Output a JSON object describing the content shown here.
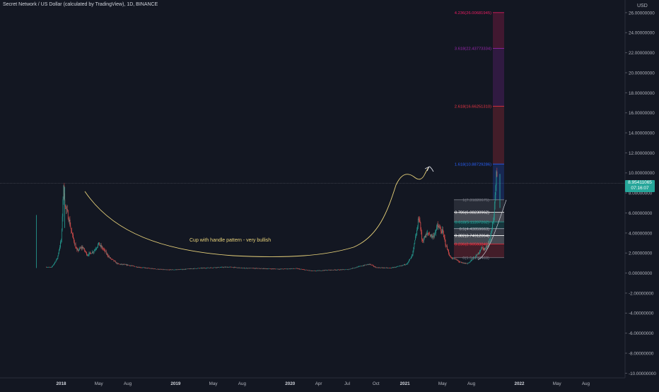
{
  "header": {
    "title": "Secret Network / US Dollar (calculated by TradingView), 1D, BINANCE",
    "currency": "USD"
  },
  "price_badge": {
    "price": "8.95411065",
    "countdown": "07:16:07"
  },
  "annotation": {
    "pattern_label": "Cup with handle pattern - very bullish"
  },
  "colors": {
    "background": "#131722",
    "up": "#26a69a",
    "down": "#ef5350",
    "cup_line": "#e8d27a",
    "grid": "#1e222d"
  },
  "chart_data": {
    "type": "candlestick",
    "title": "Secret Network / US Dollar (calculated by TradingView), 1D, BINANCE",
    "ylabel": "",
    "xlabel": "",
    "ylim": [
      -10,
      27
    ],
    "grid": false,
    "y_ticks": [
      "26.00000000",
      "24.00000000",
      "22.00000000",
      "20.00000000",
      "18.00000000",
      "16.00000000",
      "14.00000000",
      "12.00000000",
      "10.00000000",
      "8.00000000",
      "6.00000000",
      "4.00000000",
      "2.00000000",
      "0.00000000",
      "-2.00000000",
      "-4.00000000",
      "-6.00000000",
      "-8.00000000",
      "-10.00000000"
    ],
    "x_ticks": [
      "2018",
      "May",
      "Aug",
      "2019",
      "May",
      "Aug",
      "2020",
      "Apr",
      "Jul",
      "Oct",
      "2021",
      "May",
      "Aug",
      "2022",
      "May",
      "Aug"
    ],
    "price_path": [
      [
        "2017-11-15",
        0.6
      ],
      [
        "2017-12-01",
        0.55
      ],
      [
        "2017-12-20",
        1.5
      ],
      [
        "2018-01-02",
        3.5
      ],
      [
        "2018-01-08",
        8.6
      ],
      [
        "2018-01-15",
        6.5
      ],
      [
        "2018-01-25",
        5.5
      ],
      [
        "2018-02-05",
        3.8
      ],
      [
        "2018-02-20",
        2.2
      ],
      [
        "2018-03-10",
        2.6
      ],
      [
        "2018-03-25",
        1.8
      ],
      [
        "2018-04-15",
        2.2
      ],
      [
        "2018-04-30",
        2.9
      ],
      [
        "2018-05-15",
        2.4
      ],
      [
        "2018-06-05",
        1.5
      ],
      [
        "2018-07-01",
        0.9
      ],
      [
        "2018-08-01",
        0.8
      ],
      [
        "2018-09-01",
        0.6
      ],
      [
        "2018-10-15",
        0.45
      ],
      [
        "2018-12-01",
        0.32
      ],
      [
        "2019-01-15",
        0.35
      ],
      [
        "2019-03-01",
        0.45
      ],
      [
        "2019-05-01",
        0.55
      ],
      [
        "2019-06-20",
        0.6
      ],
      [
        "2019-08-01",
        0.5
      ],
      [
        "2019-10-01",
        0.45
      ],
      [
        "2019-12-01",
        0.4
      ],
      [
        "2020-01-20",
        0.45
      ],
      [
        "2020-03-13",
        0.2
      ],
      [
        "2020-05-01",
        0.3
      ],
      [
        "2020-07-01",
        0.35
      ],
      [
        "2020-08-15",
        0.7
      ],
      [
        "2020-09-10",
        0.9
      ],
      [
        "2020-10-01",
        0.55
      ],
      [
        "2020-11-15",
        0.5
      ],
      [
        "2020-12-20",
        0.7
      ],
      [
        "2021-01-10",
        1.0
      ],
      [
        "2021-01-25",
        1.8
      ],
      [
        "2021-02-08",
        4.2
      ],
      [
        "2021-02-15",
        5.8
      ],
      [
        "2021-02-25",
        3.2
      ],
      [
        "2021-03-15",
        4.0
      ],
      [
        "2021-04-01",
        3.6
      ],
      [
        "2021-04-15",
        4.7
      ],
      [
        "2021-05-01",
        4.1
      ],
      [
        "2021-05-12",
        2.8
      ],
      [
        "2021-05-25",
        1.6
      ],
      [
        "2021-06-15",
        1.3
      ],
      [
        "2021-07-01",
        1.0
      ],
      [
        "2021-07-20",
        0.95
      ],
      [
        "2021-08-05",
        1.4
      ],
      [
        "2021-08-20",
        1.8
      ],
      [
        "2021-09-01",
        2.5
      ],
      [
        "2021-09-15",
        2.4
      ],
      [
        "2021-10-01",
        3.5
      ],
      [
        "2021-10-10",
        5.5
      ],
      [
        "2021-10-15",
        7.0
      ],
      [
        "2021-10-20",
        9.8
      ],
      [
        "2021-10-23",
        8.95
      ]
    ],
    "fib_levels": [
      {
        "label": "0(1.54296469)",
        "value": 1.54296469,
        "color": "#787b86"
      },
      {
        "label": "0.236(2.90593849)",
        "value": 2.90593849,
        "color": "#f23645"
      },
      {
        "label": "0.382(3.74912064)",
        "value": 3.74912064,
        "color": "#ffffff"
      },
      {
        "label": "0.5(4.43059663)",
        "value": 4.43059663,
        "color": "#b2b5be"
      },
      {
        "label": "0.618(5.11207262)",
        "value": 5.11207262,
        "color": "#26a69a"
      },
      {
        "label": "0.786(6.08230962)",
        "value": 6.08230962,
        "color": "#ffffff"
      },
      {
        "label": "1(7.31820675)",
        "value": 7.31820675,
        "color": "#787b86"
      },
      {
        "label": "1.618(10.88729286)",
        "value": 10.88729286,
        "color": "#2962ff"
      },
      {
        "label": "2.618(16.66251310)",
        "value": 16.6625131,
        "color": "#f23645"
      },
      {
        "label": "3.618(22.43773334)",
        "value": 22.43773334,
        "color": "#9c27b0"
      },
      {
        "label": "4.236(26.00681945)",
        "value": 26.00681945,
        "color": "#e91e63"
      }
    ]
  }
}
